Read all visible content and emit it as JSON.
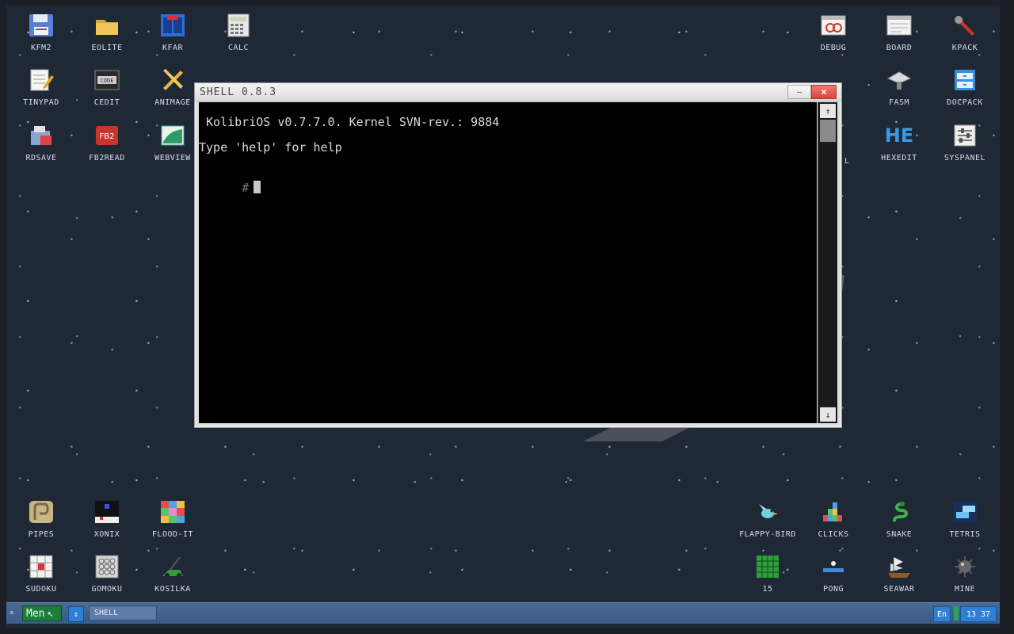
{
  "desktop": {
    "icons_top_left": [
      {
        "label": "KFM2",
        "icon": "floppy-icon"
      },
      {
        "label": "EOLITE",
        "icon": "folder-icon"
      },
      {
        "label": "KFAR",
        "icon": "kfar-icon"
      },
      {
        "label": "CALC",
        "icon": "calculator-icon"
      },
      {
        "label": "TINYPAD",
        "icon": "notepad-icon"
      },
      {
        "label": "CEDIT",
        "icon": "code-icon"
      },
      {
        "label": "ANIMAGE",
        "icon": "paint-tools-icon"
      },
      {
        "label": "RDSAVE",
        "icon": "rdsave-icon"
      },
      {
        "label": "FB2READ",
        "icon": "fb2-book-icon"
      },
      {
        "label": "WEBVIEW",
        "icon": "webview-icon"
      }
    ],
    "icons_top_right": [
      {
        "label": "DEBUG",
        "icon": "debug-icon"
      },
      {
        "label": "BOARD",
        "icon": "board-icon"
      },
      {
        "label": "KPACK",
        "icon": "wrench-icon"
      },
      {
        "label": "FASM",
        "icon": "fasm-icon"
      },
      {
        "label": "DOCPACK",
        "icon": "docpack-icon"
      },
      {
        "label": "HEXEDIT",
        "icon": "hex-icon",
        "glyph": "HE"
      },
      {
        "label": "SYSPANEL",
        "icon": "sliders-icon"
      }
    ],
    "icons_bottom_left": [
      {
        "label": "PIPES",
        "icon": "pipes-icon"
      },
      {
        "label": "XONIX",
        "icon": "xonix-icon"
      },
      {
        "label": "FLOOD-IT",
        "icon": "flood-it-icon"
      },
      {
        "label": "SUDOKU",
        "icon": "sudoku-icon"
      },
      {
        "label": "GOMOKU",
        "icon": "gomoku-icon"
      },
      {
        "label": "KOSILKA",
        "icon": "lawnmower-icon"
      }
    ],
    "icons_bottom_right": [
      {
        "label": "FLAPPY-BIRD",
        "icon": "bird-icon"
      },
      {
        "label": "CLICKS",
        "icon": "clicks-icon"
      },
      {
        "label": "SNAKE",
        "icon": "snake-icon"
      },
      {
        "label": "TETRIS",
        "icon": "tetris-icon"
      },
      {
        "label": "15",
        "icon": "fifteen-icon"
      },
      {
        "label": "PONG",
        "icon": "pong-icon"
      },
      {
        "label": "SEAWAR",
        "icon": "ship-icon"
      },
      {
        "label": "MINE",
        "icon": "mine-icon"
      }
    ],
    "partial_labels": {
      "under_window_row3": "L"
    }
  },
  "shell_window": {
    "title": "SHELL 0.8.3",
    "minimize_glyph": "—",
    "close_glyph": "×",
    "lines": [
      " KolibriOS v0.7.7.0. Kernel SVN-rev.: 9884",
      "Type 'help' for help"
    ],
    "prompt": "#",
    "scroll_up": "↑",
    "scroll_down": "↓"
  },
  "taskbar": {
    "menu_label": "Men",
    "menu_cursor": "↖",
    "switch_glyph": "⇕",
    "task_label": "SHELL",
    "language": "En",
    "clock": "13 37"
  },
  "colors": {
    "desktop_bg": "#1f2835",
    "taskbar": "#4a6a96",
    "menu_green": "#1f7d3c",
    "tray_blue": "#2e7fd6",
    "close_red": "#d8463b"
  }
}
